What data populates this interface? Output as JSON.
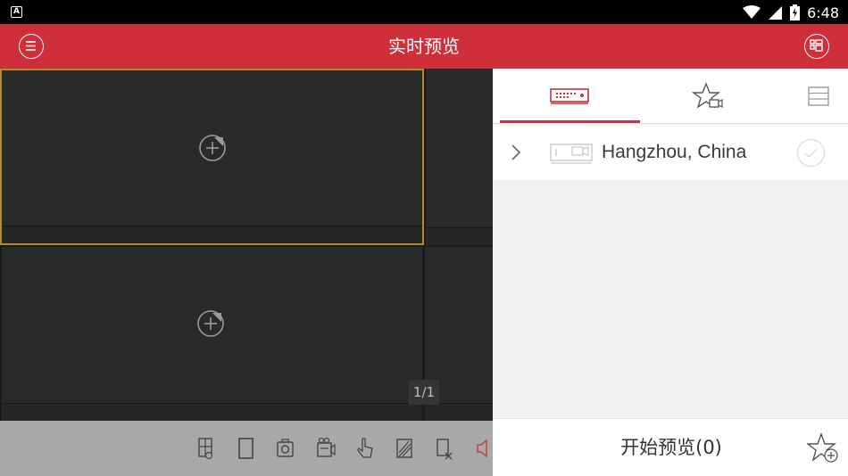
{
  "status_bar": {
    "time": "6:48",
    "left_icon": "android-notification-icon",
    "icons": [
      "wifi-icon",
      "signal-icon",
      "battery-charging-icon"
    ]
  },
  "app_bar": {
    "title": "实时预览",
    "left_icon": "menu-icon",
    "right_icon": "window-layout-icon",
    "color": "#cf2f3b"
  },
  "video_grid": {
    "page_indicator": "1/1",
    "selected_border_color": "#b38b2a",
    "add_icon": "add-camera-icon"
  },
  "toolbar": {
    "icons": [
      "window-split-icon",
      "single-window-icon",
      "capture-icon",
      "record-icon",
      "ptz-icon",
      "quality-icon",
      "close-all-icon",
      "audio-icon"
    ]
  },
  "panel": {
    "tabs": [
      {
        "icon": "device-dvr-icon",
        "active": true
      },
      {
        "icon": "favorite-camera-icon",
        "active": false
      },
      {
        "icon": "list-icon",
        "active": false
      }
    ],
    "device": {
      "name": "Hangzhou, China"
    },
    "start_preview_label": "开始预览(0)",
    "add_favorite_icon": "add-favorite-icon"
  }
}
